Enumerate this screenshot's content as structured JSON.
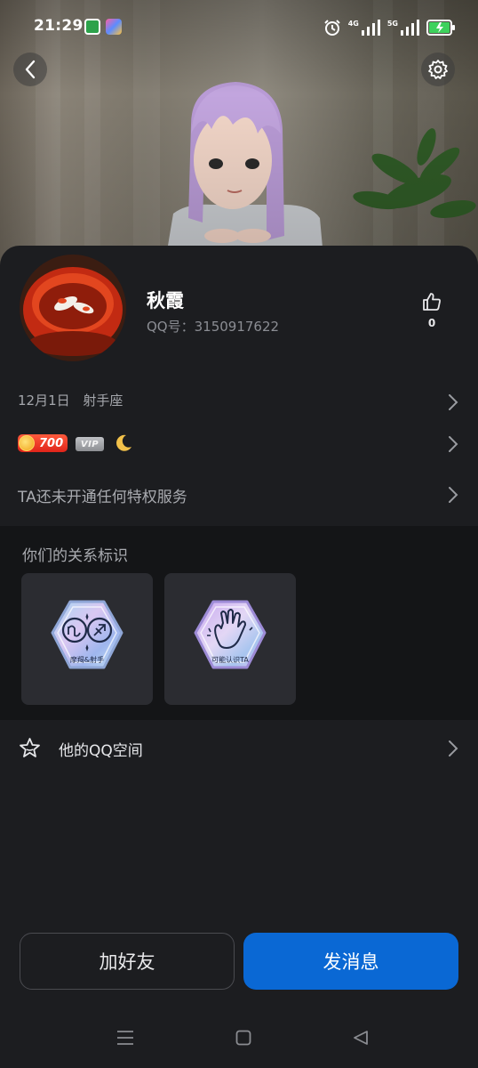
{
  "status_bar": {
    "time": "21:29",
    "network_1": "4G",
    "network_2": "5G",
    "icons": [
      "shield-app-icon",
      "colorful-app-icon",
      "alarm-icon",
      "signal-icon",
      "signal-icon",
      "battery-charging-icon"
    ]
  },
  "header": {
    "back_icon": "back-arrow-icon",
    "settings_icon": "gear-icon"
  },
  "profile": {
    "name": "秋霞",
    "qq_label": "QQ号：3150917622",
    "likes": "0"
  },
  "info_rows": {
    "birthday": "12月1日",
    "zodiac": "射手座",
    "coin_level": "700",
    "vip_label": "VIP",
    "privilege_text": "TA还未开通任何特权服务"
  },
  "relationship": {
    "title": "你们的关系标识",
    "cards": [
      {
        "label": "摩羯&射手",
        "icon": "zodiac-badge-icon"
      },
      {
        "label": "可能认识TA",
        "icon": "hand-wave-badge-icon"
      }
    ]
  },
  "qzone": {
    "label": "他的QQ空间",
    "icon": "star-icon"
  },
  "actions": {
    "add_friend": "加好友",
    "send_message": "发消息"
  },
  "colors": {
    "primary": "#0a68d4",
    "background": "#1c1d20",
    "section_dark": "#141517",
    "card": "#2b2c31"
  }
}
